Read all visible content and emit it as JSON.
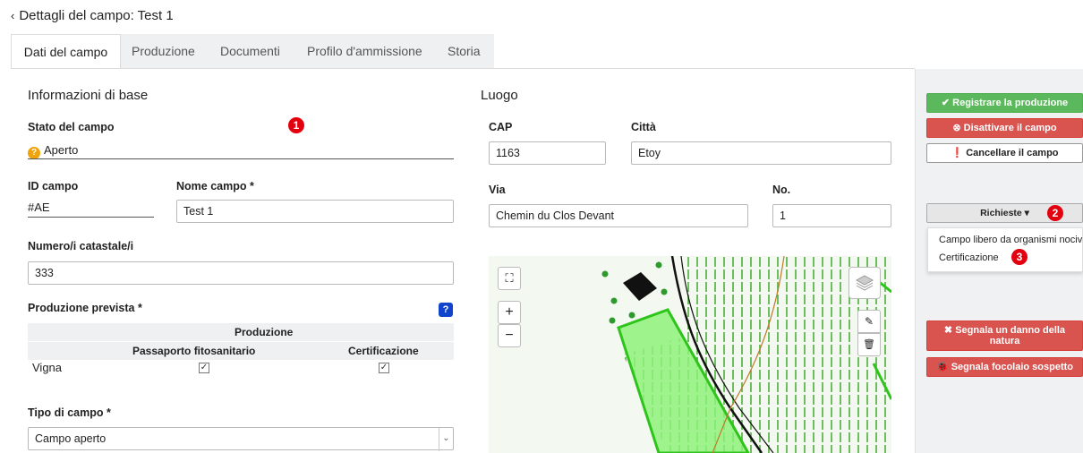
{
  "header": {
    "back_icon": "‹",
    "title": "Dettagli del campo: Test 1"
  },
  "tabs": [
    {
      "label": "Dati del campo",
      "active": true
    },
    {
      "label": "Produzione"
    },
    {
      "label": "Documenti"
    },
    {
      "label": "Profilo d'ammissione"
    },
    {
      "label": "Storia"
    }
  ],
  "info": {
    "section_title": "Informazioni di base",
    "stato_label": "Stato del campo",
    "stato_value": "Aperto",
    "id_label": "ID campo",
    "id_value": "#AE",
    "nome_label": "Nome campo *",
    "nome_value": "Test 1",
    "catastale_label": "Numero/i catastale/i",
    "catastale_value": "333",
    "produzione_label": "Produzione prevista *",
    "help_icon": "?",
    "prod_table": {
      "group_header": "Produzione",
      "col1": "Passaporto fitosanitario",
      "col2": "Certificazione",
      "row_label": "Vigna",
      "check": "✓"
    },
    "tipo_label": "Tipo di campo *",
    "tipo_value": "Campo aperto"
  },
  "luogo": {
    "section_title": "Luogo",
    "cap_label": "CAP",
    "cap_value": "1163",
    "citta_label": "Città",
    "citta_value": "Etoy",
    "via_label": "Via",
    "via_value": "Chemin du Clos Devant",
    "no_label": "No.",
    "no_value": "1"
  },
  "map": {
    "fullscreen_icon": "⛶",
    "zoom_in": "+",
    "zoom_out": "−",
    "layers_icon": "layers-icon",
    "edit_icon": "✎",
    "trash_icon": "🗑"
  },
  "actions": {
    "registrare": "✔ Registrare la produzione",
    "disattivare": "⊗ Disattivare il campo",
    "cancellare": "❗ Cancellare il campo",
    "richieste": "Richieste ▾",
    "danno_line1": "✖ Segnala un danno della",
    "danno_line2": "natura",
    "focolaio": "🐞 Segnala focolaio sospetto"
  },
  "dropdown": {
    "item1": "Campo libero da organismi nocivi",
    "item2": "Certificazione"
  },
  "badges": {
    "b1": "1",
    "b2": "2",
    "b3": "3"
  },
  "colors": {
    "green_button": "#5cb85c",
    "red_button": "#d9534f",
    "badge_red": "#e3000f",
    "help_blue": "#1144cc",
    "warning_orange": "#f0a30a"
  }
}
